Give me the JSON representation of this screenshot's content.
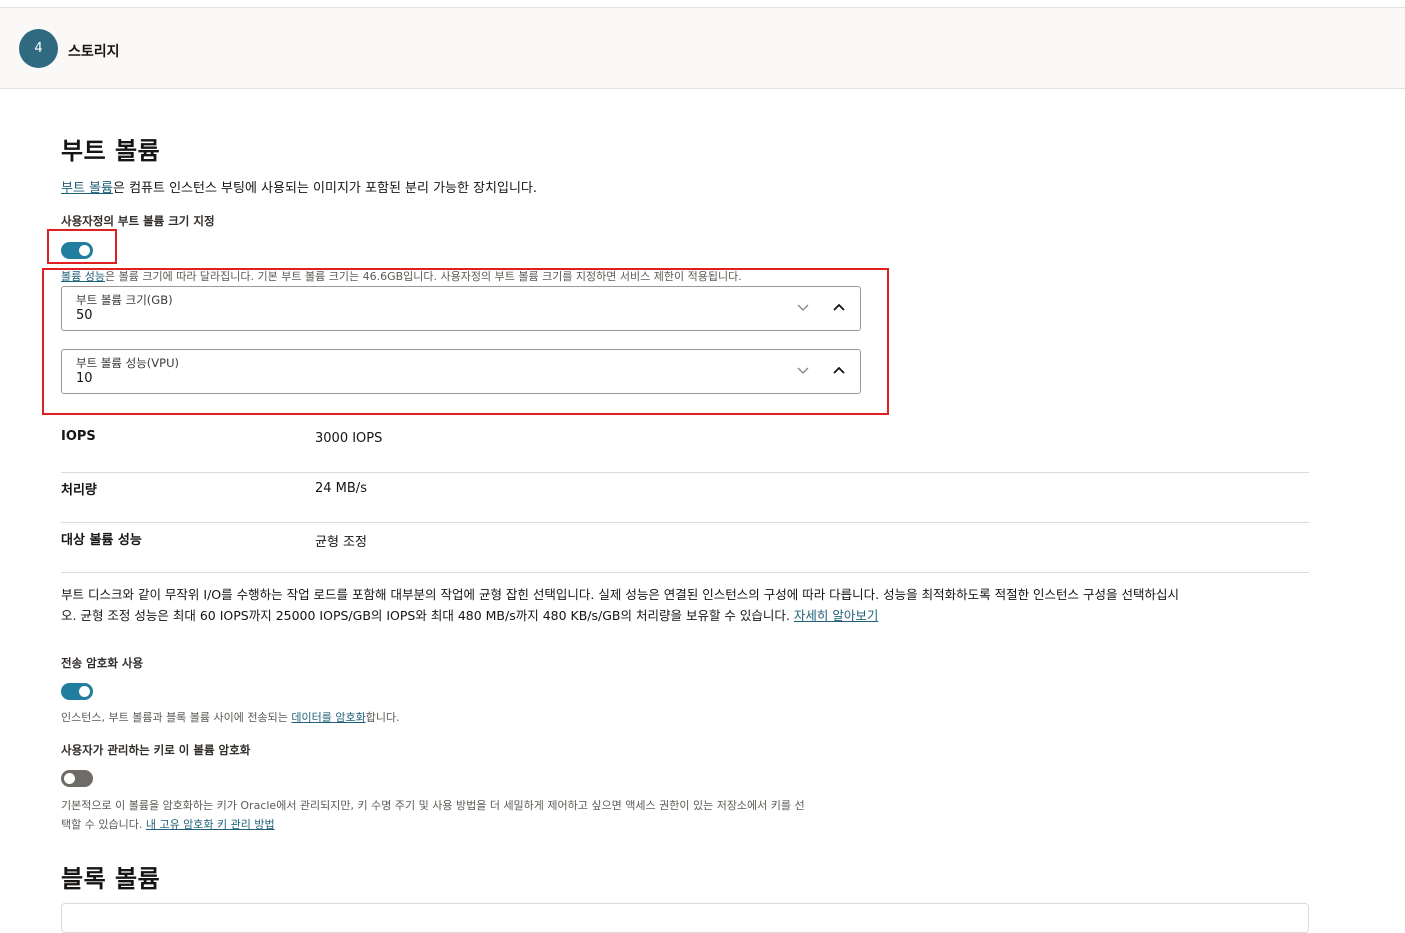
{
  "step": {
    "number": "4",
    "title": "스토리지"
  },
  "boot_volume": {
    "heading": "부트 볼륨",
    "intro_link": "부트 볼륨",
    "intro_text": "은 컴퓨트 인스턴스 부팅에 사용되는 이미지가 포함된 분리 가능한 장치입니다.",
    "custom_size_label": "사용자정의 부트 볼륨 크기 지정",
    "custom_size_enabled": true,
    "perf_note_link": "볼륨 성능",
    "perf_note_text": "은 볼륨 크기에 따라 달라집니다. 기본 부트 볼륨 크기는 46.6GB입니다. 사용자정의 부트 볼륨 크기를 지정하면 서비스 제한이 적용됩니다.",
    "size_field": {
      "label": "부트 볼륨 크기(GB)",
      "value": "50"
    },
    "vpu_field": {
      "label": "부트 볼륨 성능(VPU)",
      "value": "10"
    }
  },
  "metrics": [
    {
      "key": "IOPS",
      "value": "3000 IOPS"
    },
    {
      "key": "처리량",
      "value": "24 MB/s"
    },
    {
      "key": "대상 볼륨 성능",
      "value": "균형 조정"
    }
  ],
  "performance_desc": {
    "line1": "부트 디스크와 같이 무작위 I/O를 수행하는 작업 로드를 포함해 대부분의 작업에 균형 잡힌 선택입니다. 실제 성능은 연결된 인스턴스의 구성에 따라 다릅니다. 성능을 최적화하도록 적절한 인스턴스 구성을 선택하십시",
    "line2": "오. 균형 조정 성능은 최대 60 IOPS까지 25000 IOPS/GB의 IOPS와 최대 480 MB/s까지 480 KB/s/GB의 처리량을 보유할 수 있습니다. ",
    "learn_more": "자세히 알아보기"
  },
  "in_transit": {
    "label": "전송 암호화 사용",
    "enabled": true,
    "note_text": "인스턴스, 부트 볼륨과 블록 볼륨 사이에 전송되는 ",
    "note_link": "데이터를 암호화",
    "note_suffix": "합니다."
  },
  "customer_key": {
    "label": "사용자가 관리하는 키로 이 볼륨 암호화",
    "enabled": false,
    "note_line1": "기본적으로 이 볼륨을 암호화하는 키가 Oracle에서 관리되지만, 키 수명 주기 및 사용 방법을 더 세밀하게 제어하고 싶으면 액세스 권한이 있는 저장소에서 키를 선",
    "note_line2": "택할 수 있습니다. ",
    "note_link": "내 고유 암호화 키 관리 방법"
  },
  "block_volume": {
    "heading": "블록 볼륨"
  },
  "colors": {
    "accent": "#227e9e",
    "highlight": "#e02020",
    "link": "#1f5f7a"
  }
}
